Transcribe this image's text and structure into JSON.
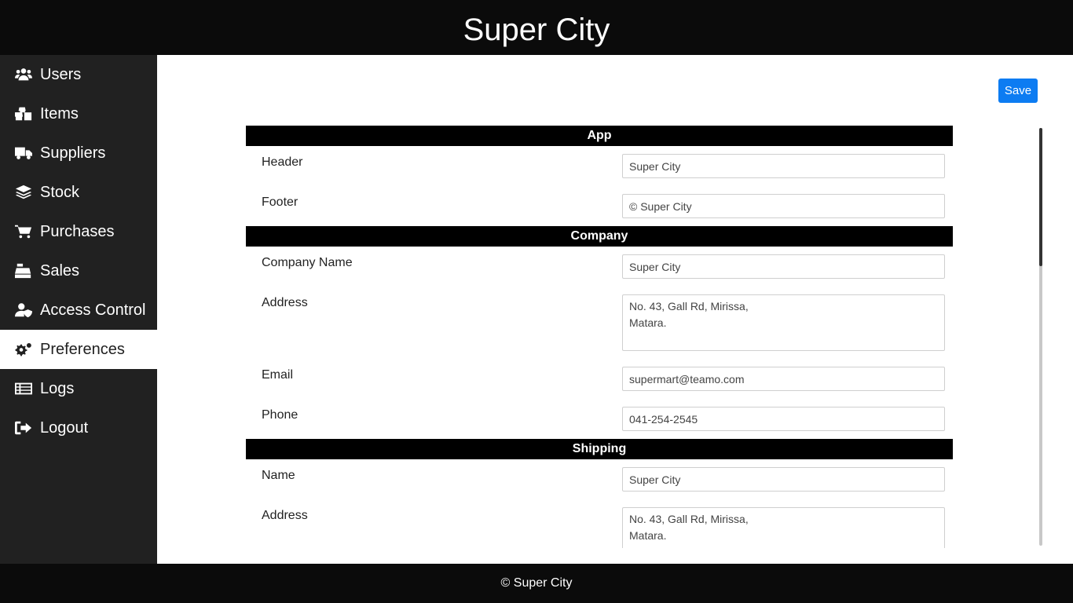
{
  "header": {
    "title": "Super City"
  },
  "sidebar": {
    "items": [
      {
        "label": "Users",
        "icon": "users-icon"
      },
      {
        "label": "Items",
        "icon": "boxes-icon"
      },
      {
        "label": "Suppliers",
        "icon": "truck-icon"
      },
      {
        "label": "Stock",
        "icon": "layers-icon"
      },
      {
        "label": "Purchases",
        "icon": "cart-icon"
      },
      {
        "label": "Sales",
        "icon": "cash-register-icon"
      },
      {
        "label": "Access Control",
        "icon": "user-shield-icon"
      },
      {
        "label": "Preferences",
        "icon": "gears-icon",
        "active": true
      },
      {
        "label": "Logs",
        "icon": "list-icon"
      },
      {
        "label": "Logout",
        "icon": "sign-out-icon"
      }
    ]
  },
  "toolbar": {
    "save_label": "Save"
  },
  "sections": {
    "app": {
      "title": "App",
      "header_label": "Header",
      "header_value": "Super City",
      "footer_label": "Footer",
      "footer_value": "© Super City"
    },
    "company": {
      "title": "Company",
      "name_label": "Company Name",
      "name_value": "Super City",
      "address_label": "Address",
      "address_value": "No. 43, Gall Rd, Mirissa,\nMatara.",
      "email_label": "Email",
      "email_value": "supermart@teamo.com",
      "phone_label": "Phone",
      "phone_value": "041-254-2545"
    },
    "shipping": {
      "title": "Shipping",
      "name_label": "Name",
      "name_value": "Super City",
      "address_label": "Address",
      "address_value": "No. 43, Gall Rd, Mirissa,\nMatara."
    }
  },
  "footer": {
    "text": "© Super City"
  },
  "colors": {
    "accent": "#0d7cf2",
    "sidebar_bg": "#212121",
    "bar_bg": "#0b0b0b"
  }
}
